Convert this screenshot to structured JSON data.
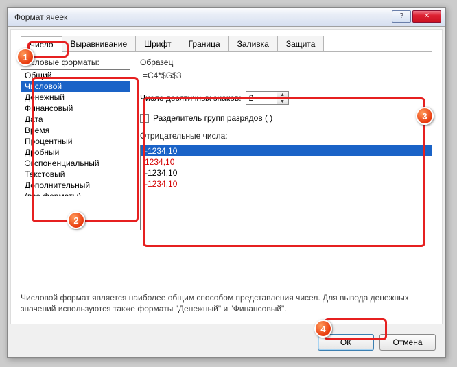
{
  "window": {
    "title": "Формат ячеек"
  },
  "tabs": {
    "items": [
      {
        "label": "Число"
      },
      {
        "label": "Выравнивание"
      },
      {
        "label": "Шрифт"
      },
      {
        "label": "Граница"
      },
      {
        "label": "Заливка"
      },
      {
        "label": "Защита"
      }
    ]
  },
  "left": {
    "label": "Числовые форматы:",
    "items": [
      "Общий",
      "Числовой",
      "Денежный",
      "Финансовый",
      "Дата",
      "Время",
      "Процентный",
      "Дробный",
      "Экспоненциальный",
      "Текстовый",
      "Дополнительный",
      "(все форматы)"
    ],
    "selected_index": 1
  },
  "sample": {
    "label": "Образец",
    "value": "=C4*$G$3"
  },
  "decimals": {
    "label": "Число десятичных знаков:",
    "value": "2"
  },
  "separator": {
    "label": "Разделитель групп разрядов ( )"
  },
  "negatives": {
    "label": "Отрицательные числа:",
    "items": [
      {
        "text": "-1234,10",
        "color": "#000000"
      },
      {
        "text": "1234,10",
        "color": "#d40000"
      },
      {
        "text": "-1234,10",
        "color": "#000000"
      },
      {
        "text": "-1234,10",
        "color": "#d40000"
      }
    ],
    "selected_index": 0
  },
  "description": "Числовой формат является наиболее общим способом представления чисел. Для вывода денежных значений используются также форматы \"Денежный\" и \"Финансовый\".",
  "buttons": {
    "ok": "ОК",
    "cancel": "Отмена"
  },
  "callouts": {
    "c1": "1",
    "c2": "2",
    "c3": "3",
    "c4": "4"
  }
}
